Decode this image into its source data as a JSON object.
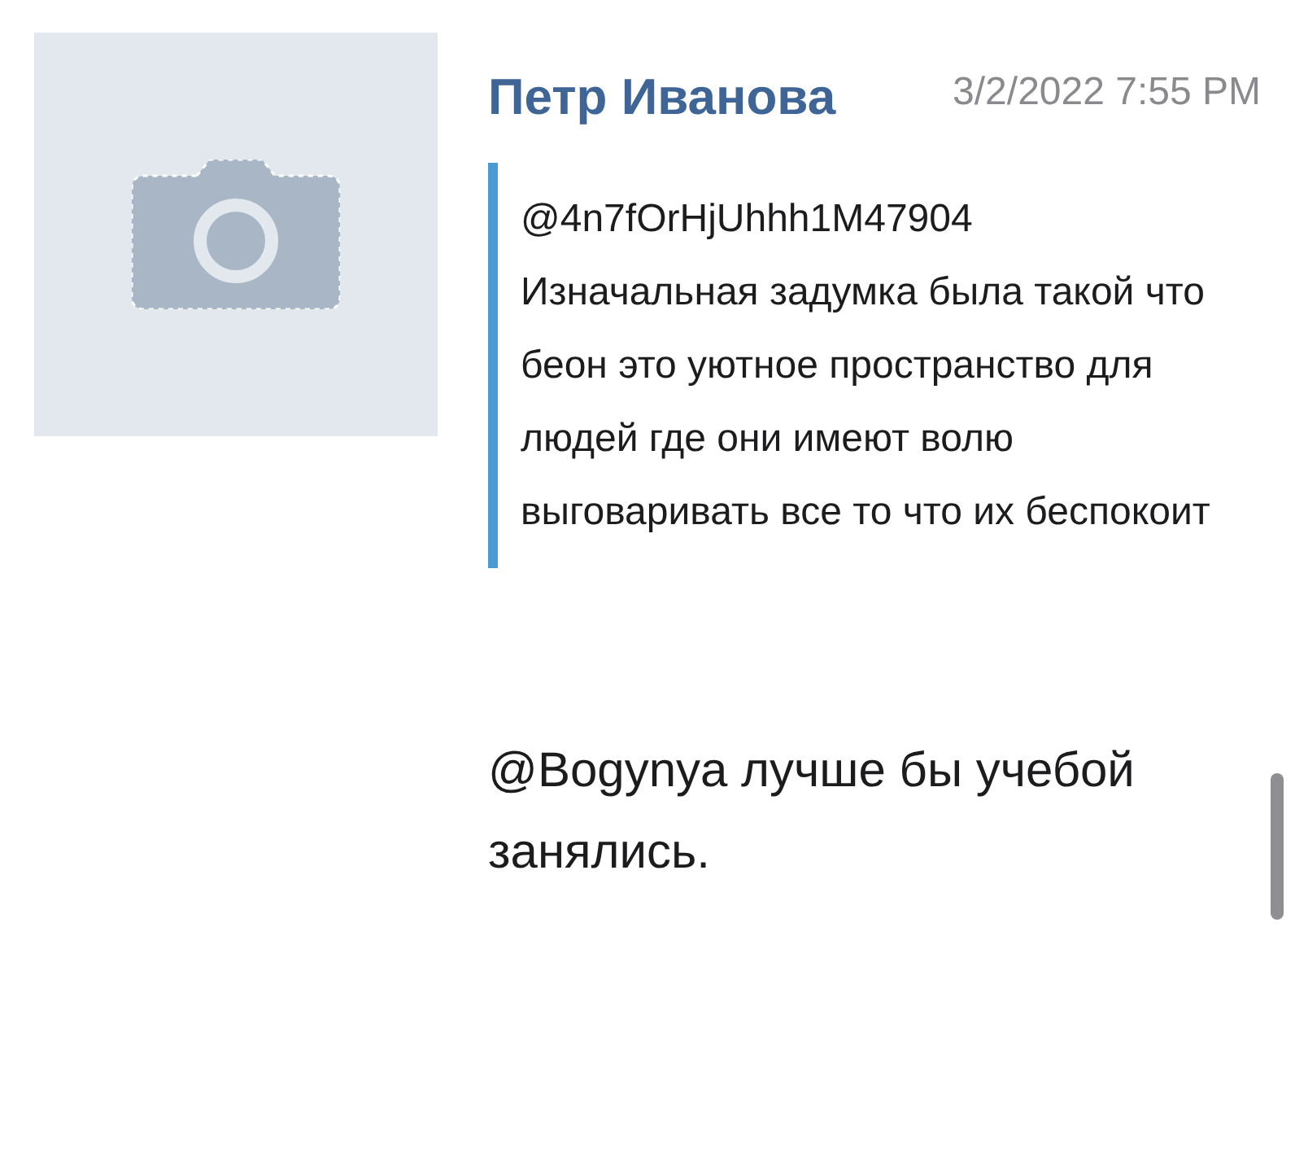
{
  "comment": {
    "author": "Петр Иванова",
    "time": "3/2/2022 7:55 PM",
    "quote": "@4n7fOrHjUhhh1M47904 Изначальная задумка была такой что беон это уютное пространство для людей где они имеют волю выговаривать все то что их беспокоит",
    "message": "@Bogynya лучше бы учебой занялись."
  }
}
